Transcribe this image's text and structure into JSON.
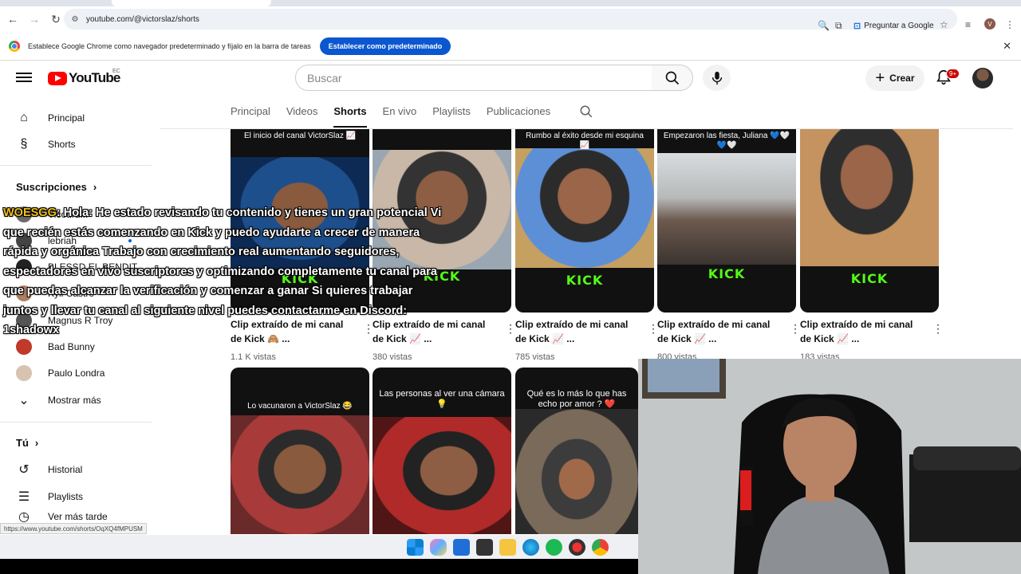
{
  "browser": {
    "url": "youtube.com/@victorslaz/shorts",
    "ask_google": "Preguntar a Google",
    "profile_initial": "V"
  },
  "infobar": {
    "message": "Establece Google Chrome como navegador predeterminado y fíjalo en la barra de tareas",
    "button": "Establecer como predeterminado"
  },
  "masthead": {
    "logo_text": "YouTube",
    "country": "EC",
    "search_placeholder": "Buscar",
    "create": "Crear",
    "notifications": "9+"
  },
  "sidebar": {
    "main": [
      {
        "label": "Principal",
        "icon": "home-icon"
      },
      {
        "label": "Shorts",
        "icon": "shorts-icon"
      }
    ],
    "subscriptions_title": "Suscripciones",
    "subscriptions": [
      {
        "label": "Vicourd..."
      },
      {
        "label": "lebriah"
      },
      {
        "label": "BLESSD EL BENDIT..."
      },
      {
        "label": "Kyli Castro"
      },
      {
        "label": "Magnus R Troy"
      },
      {
        "label": "Bad Bunny"
      },
      {
        "label": "Paulo Londra"
      }
    ],
    "show_more": "Mostrar más",
    "you_title": "Tú",
    "you": [
      {
        "label": "Historial",
        "icon": "history-icon"
      },
      {
        "label": "Playlists",
        "icon": "playlists-icon"
      },
      {
        "label": "Ver más tarde",
        "icon": "watch-later-icon"
      }
    ]
  },
  "channel_tabs": [
    "Principal",
    "Videos",
    "Shorts",
    "En vivo",
    "Playlists",
    "Publicaciones"
  ],
  "active_tab": "Shorts",
  "shorts": [
    {
      "caption": "El inicio del canal VictorSlaz 📈",
      "title": "Clip extraído de mi canal de Kick 🙈 ...",
      "views": "1.1 K vistas"
    },
    {
      "caption": "",
      "title": "Clip extraído de mi canal de Kick 📈 ...",
      "views": "380 vistas"
    },
    {
      "caption": "Rumbo al éxito desde mi esquina 📈",
      "title": "Clip extraído de mi canal de Kick 📈 ...",
      "views": "785 vistas"
    },
    {
      "caption": "Empezaron las fiesta, Juliana 💙🤍💙🤍",
      "title": "Clip extraído de mi canal de Kick 📈 ...",
      "views": "800 vistas"
    },
    {
      "caption": "",
      "title": "Clip extraído de mi canal de Kick 📈 ...",
      "views": "183 vistas"
    },
    {
      "caption": "Lo vacunaron a VictorSlaz 😂",
      "title": "",
      "views": ""
    },
    {
      "caption": "Las personas al ver una cámara 💡",
      "title": "",
      "views": ""
    },
    {
      "caption": "Qué es lo más lo que has echo por amor ? ❤️",
      "title": "",
      "views": ""
    }
  ],
  "kick_label": "KICK",
  "overlay": {
    "user": "WOESGG",
    "message": ": Hola: He estado revisando tu contenido y tienes un gran potencial Vi que recién estás comenzando en Kick y puedo ayudarte a crecer de manera rápida y orgánica Trabajo con crecimiento real aumentando seguidores, espectadores en vivo suscriptores y optimizando completamente tu canal para que puedas alcanzar la verificación y comenzar a ganar Si quieres trabajar juntos y llevar tu canal al siguiente nivel puedes contactarme en Discord: 1shadowx"
  },
  "status_url": "https://www.youtube.com/shorts/OqXQ4fMPUSM",
  "colors": {
    "yt_red": "#ff0000",
    "kick_green": "#53fc18",
    "chrome_blue": "#0b57d0"
  }
}
